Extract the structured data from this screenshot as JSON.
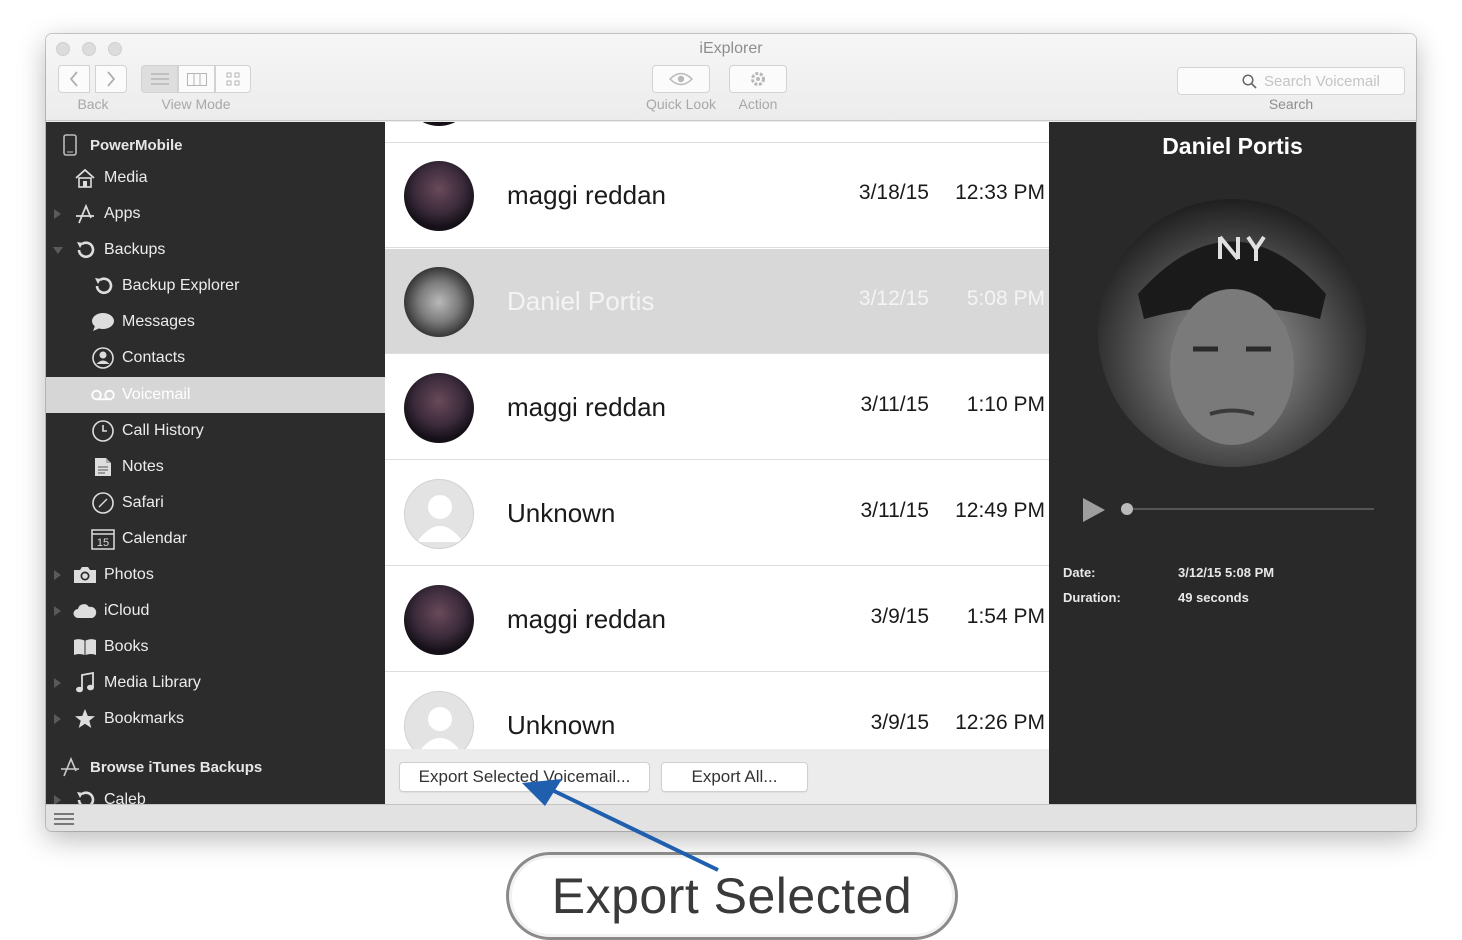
{
  "window": {
    "title": "iExplorer"
  },
  "toolbar": {
    "back_label": "Back",
    "view_mode_label": "View Mode",
    "quick_look_label": "Quick Look",
    "action_label": "Action",
    "search_label": "Search",
    "search_placeholder": "Search Voicemail"
  },
  "sidebar": {
    "device": "PowerMobile",
    "items": [
      {
        "label": "Media",
        "icon": "home-icon"
      },
      {
        "label": "Apps",
        "icon": "apps-icon"
      },
      {
        "label": "Backups",
        "icon": "backup-icon"
      },
      {
        "label": "Backup Explorer",
        "icon": "backup-icon"
      },
      {
        "label": "Messages",
        "icon": "speech-bubble-icon"
      },
      {
        "label": "Contacts",
        "icon": "contact-icon"
      },
      {
        "label": "Voicemail",
        "icon": "voicemail-icon"
      },
      {
        "label": "Call History",
        "icon": "clock-icon"
      },
      {
        "label": "Notes",
        "icon": "notes-icon"
      },
      {
        "label": "Safari",
        "icon": "compass-icon"
      },
      {
        "label": "Calendar",
        "icon": "calendar-icon",
        "badge": "15"
      },
      {
        "label": "Photos",
        "icon": "camera-icon"
      },
      {
        "label": "iCloud",
        "icon": "cloud-icon"
      },
      {
        "label": "Books",
        "icon": "book-icon"
      },
      {
        "label": "Media Library",
        "icon": "music-note-icon"
      },
      {
        "label": "Bookmarks",
        "icon": "star-icon"
      }
    ],
    "browse_label": "Browse iTunes Backups",
    "backup_entry": "Caleb"
  },
  "voicemails": [
    {
      "name": "maggi reddan",
      "date": "3/18/15",
      "time": "12:33 PM"
    },
    {
      "name": "Daniel Portis",
      "date": "3/12/15",
      "time": "5:08 PM"
    },
    {
      "name": "maggi reddan",
      "date": "3/11/15",
      "time": "1:10 PM"
    },
    {
      "name": "Unknown",
      "date": "3/11/15",
      "time": "12:49 PM"
    },
    {
      "name": "maggi reddan",
      "date": "3/9/15",
      "time": "1:54 PM"
    },
    {
      "name": "Unknown",
      "date": "3/9/15",
      "time": "12:26 PM"
    }
  ],
  "footer": {
    "export_selected": "Export Selected Voicemail...",
    "export_all": "Export All..."
  },
  "detail": {
    "name": "Daniel Portis",
    "date_label": "Date:",
    "date_value": "3/12/15 5:08 PM",
    "duration_label": "Duration:",
    "duration_value": "49 seconds"
  },
  "callout": {
    "text": "Export Selected"
  },
  "colors": {
    "sidebar_bg": "#2c2c2c",
    "detail_bg": "#292929",
    "selection": "#d6d6d6",
    "arrow": "#1f5fae"
  }
}
